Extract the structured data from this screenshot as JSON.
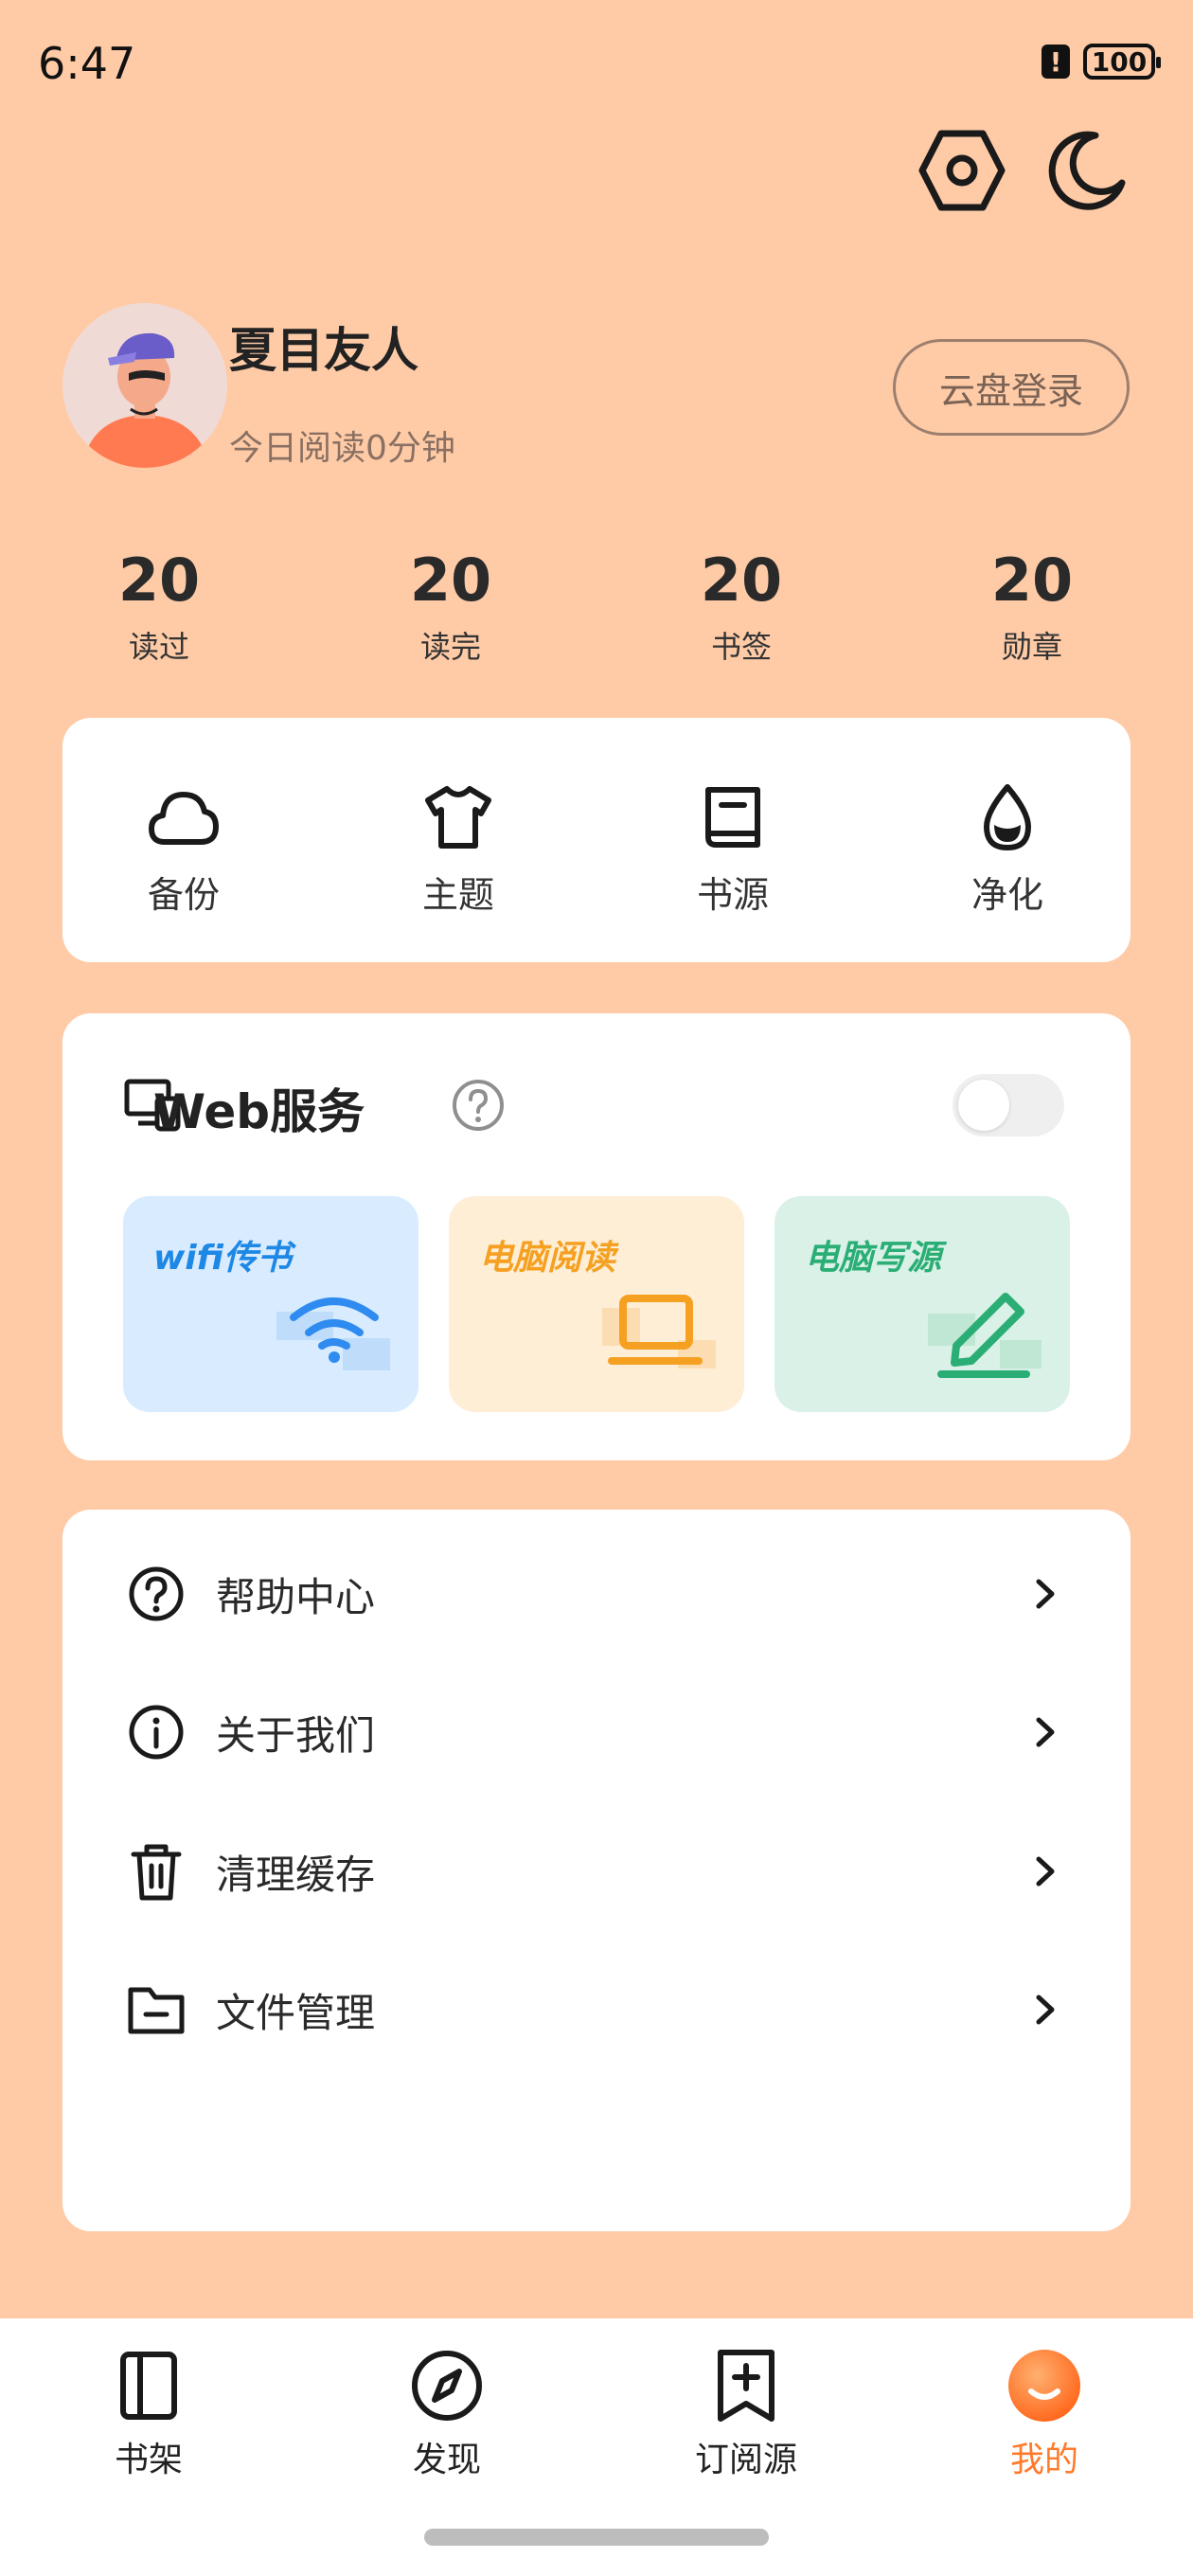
{
  "status_bar": {
    "time": "6:47",
    "battery": "100",
    "alert": "!"
  },
  "top_actions": {
    "settings_icon": "hexagon-gear-icon",
    "night_mode_icon": "moon-icon"
  },
  "profile": {
    "name": "夏目友人",
    "subtitle": "今日阅读0分钟",
    "cloud_login_label": "云盘登录"
  },
  "stats": [
    {
      "value": "20",
      "label": "读过"
    },
    {
      "value": "20",
      "label": "读完"
    },
    {
      "value": "20",
      "label": "书签"
    },
    {
      "value": "20",
      "label": "勋章"
    }
  ],
  "quick_actions": [
    {
      "label": "备份",
      "icon": "cloud-icon"
    },
    {
      "label": "主题",
      "icon": "tshirt-icon"
    },
    {
      "label": "书源",
      "icon": "book-icon"
    },
    {
      "label": "净化",
      "icon": "drop-icon"
    }
  ],
  "web_service": {
    "title": "Web服务",
    "help_icon": "help-circle-icon",
    "enabled": false,
    "tiles": [
      {
        "label": "wifi传书",
        "color": "#1E88E5",
        "bg": "#D8EBFF"
      },
      {
        "label": "电脑阅读",
        "color": "#F5A021",
        "bg": "#FFEED6"
      },
      {
        "label": "电脑写源",
        "color": "#2BAE76",
        "bg": "#D9F1E6"
      }
    ]
  },
  "menu": [
    {
      "label": "帮助中心",
      "icon": "question-circle-icon"
    },
    {
      "label": "关于我们",
      "icon": "info-circle-icon"
    },
    {
      "label": "清理缓存",
      "icon": "trash-icon"
    },
    {
      "label": "文件管理",
      "icon": "folder-icon"
    }
  ],
  "bottom_nav": [
    {
      "label": "书架",
      "icon": "bookshelf-icon",
      "active": false
    },
    {
      "label": "发现",
      "icon": "compass-icon",
      "active": false
    },
    {
      "label": "订阅源",
      "icon": "bookmark-plus-icon",
      "active": false
    },
    {
      "label": "我的",
      "icon": "profile-orb-icon",
      "active": true
    }
  ],
  "colors": {
    "background": "#FFCBA7",
    "card": "#FFFFFF",
    "accent": "#FF7A2B"
  }
}
